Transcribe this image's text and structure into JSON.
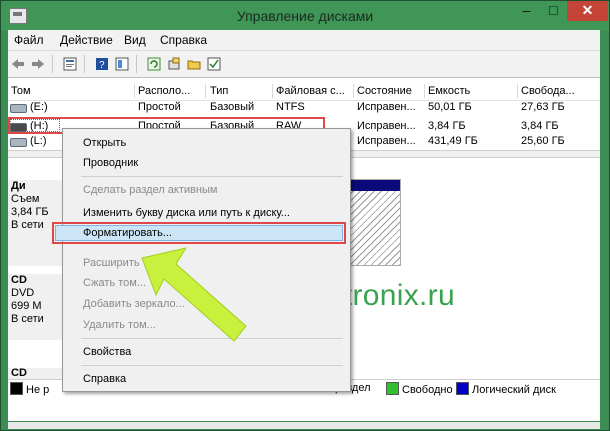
{
  "window": {
    "title": "Управление дисками",
    "close_glyph": "✕",
    "min_glyph": "–",
    "max_glyph": "□"
  },
  "menu": [
    "Файл",
    "Действие",
    "Вид",
    "Справка"
  ],
  "toolbar_icons": [
    "back-icon",
    "forward-icon",
    "properties-icon",
    "help-icon",
    "console-icon",
    "refresh-icon",
    "settings-icon",
    "folder-icon",
    "check-icon"
  ],
  "table": {
    "columns": [
      "Том",
      "Располо...",
      "Тип",
      "Файловая с...",
      "Состояние",
      "Емкость",
      "Свобода..."
    ],
    "rows": [
      [
        "(E:)",
        "Простой",
        "Базовый",
        "NTFS",
        "Исправен...",
        "50,01 ГБ",
        "27,63 ГБ"
      ],
      [
        "(H:)",
        "Простой",
        "Базовый",
        "RAW",
        "Исправен...",
        "3,84 ГБ",
        "3,84 ГБ"
      ],
      [
        "(L:)",
        "",
        "",
        "",
        "Исправен...",
        "431,49 ГБ",
        "25,60 ГБ"
      ]
    ]
  },
  "disks": [
    {
      "lines": [
        "Ди",
        "Съем",
        "3,84 ГБ",
        "В сети"
      ]
    },
    {
      "lines": [
        "CD",
        "DVD",
        "699 М",
        "В сети"
      ]
    },
    {
      "lines": [
        "CD"
      ]
    }
  ],
  "legend": {
    "items": [
      {
        "label": "Не р",
        "color": "#000000"
      },
      {
        "label": "раздел",
        "color": "#0000a0"
      },
      {
        "label": "Свободно",
        "color": "#2fc02f"
      },
      {
        "label": "Логический диск",
        "color": "#0000c8"
      }
    ]
  },
  "context_menu": {
    "items": [
      {
        "label": "Открыть",
        "enabled": true
      },
      {
        "label": "Проводник",
        "enabled": true
      },
      {
        "label": "Сделать раздел активным",
        "enabled": false
      },
      {
        "label": "Изменить букву диска или путь к диску...",
        "enabled": true
      },
      {
        "label": "Форматировать...",
        "enabled": true,
        "highlighted": true
      },
      {
        "label": "Расширить",
        "enabled": false
      },
      {
        "label": "Сжать том...",
        "enabled": false
      },
      {
        "label": "Добавить зеркало...",
        "enabled": false
      },
      {
        "label": "Удалить том...",
        "enabled": false
      },
      {
        "label": "Свойства",
        "enabled": true
      },
      {
        "label": "Справка",
        "enabled": true
      }
    ]
  },
  "watermark": "smartronix.ru",
  "colors": {
    "title_bar": "#3f9657",
    "highlight_border": "#e04848",
    "arrow": "#c8f03c",
    "watermark": "#3aa24f"
  }
}
